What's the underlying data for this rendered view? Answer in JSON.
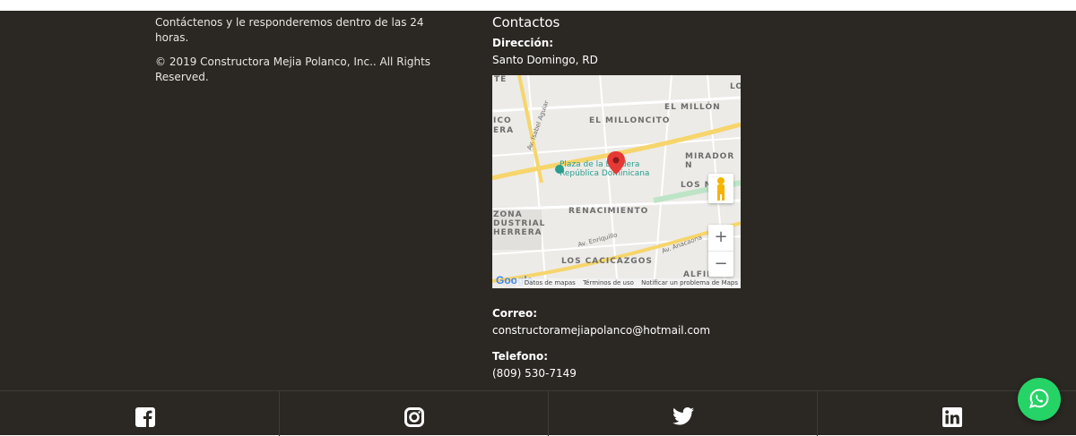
{
  "about": {
    "tagline": "Contáctenos y le responderemos dentro de las 24 horas.",
    "copyright": "© 2019 Constructora Mejia Polanco, Inc.. All Rights Reserved."
  },
  "contacts": {
    "title": "Contactos",
    "address_label": "Dirección:",
    "address_value": "Santo Domingo, RD",
    "email_label": "Correo:",
    "email_value": "constructoramejiapolanco@hotmail.com",
    "phone_label": "Telefono:",
    "phone_value": "(809) 530-7149"
  },
  "map": {
    "labels": {
      "el_millon": "EL MILLÓN",
      "el_milloncito": "EL MILLONCITO",
      "plaza": "Plaza de la Bandera",
      "republica": "República Dominicana",
      "mirador": "MIRADOR N",
      "los": "LOS M",
      "renacimiento": "RENACIMIENTO",
      "zona": "ZONA",
      "industrial": "DUSTRIAL",
      "herrera": "HERRERA",
      "los_cacicazgos": "LOS CACICAZGOS",
      "alfimar": "ALFIMAR",
      "ico": "ICO",
      "era": "ERA",
      "te": "TE",
      "lo": "LO",
      "av_enriquillo": "Av. Enriquillo",
      "av_anacaona": "Av. Anacaona",
      "av_isabel": "Av. Isabel Aguiar"
    },
    "zoom_in": "+",
    "zoom_out": "−",
    "attribution": {
      "google": "Google",
      "data": "Datos de mapas",
      "terms": "Términos de uso",
      "report": "Notificar un problema de Maps"
    }
  },
  "social": {
    "items": [
      {
        "name": "facebook-icon"
      },
      {
        "name": "instagram-icon"
      },
      {
        "name": "twitter-icon"
      },
      {
        "name": "linkedin-icon"
      }
    ],
    "whatsapp": "whatsapp-icon"
  },
  "colors": {
    "footer_bg": "#2b2723",
    "whatsapp": "#25d366",
    "map_pin": "#e53935"
  }
}
